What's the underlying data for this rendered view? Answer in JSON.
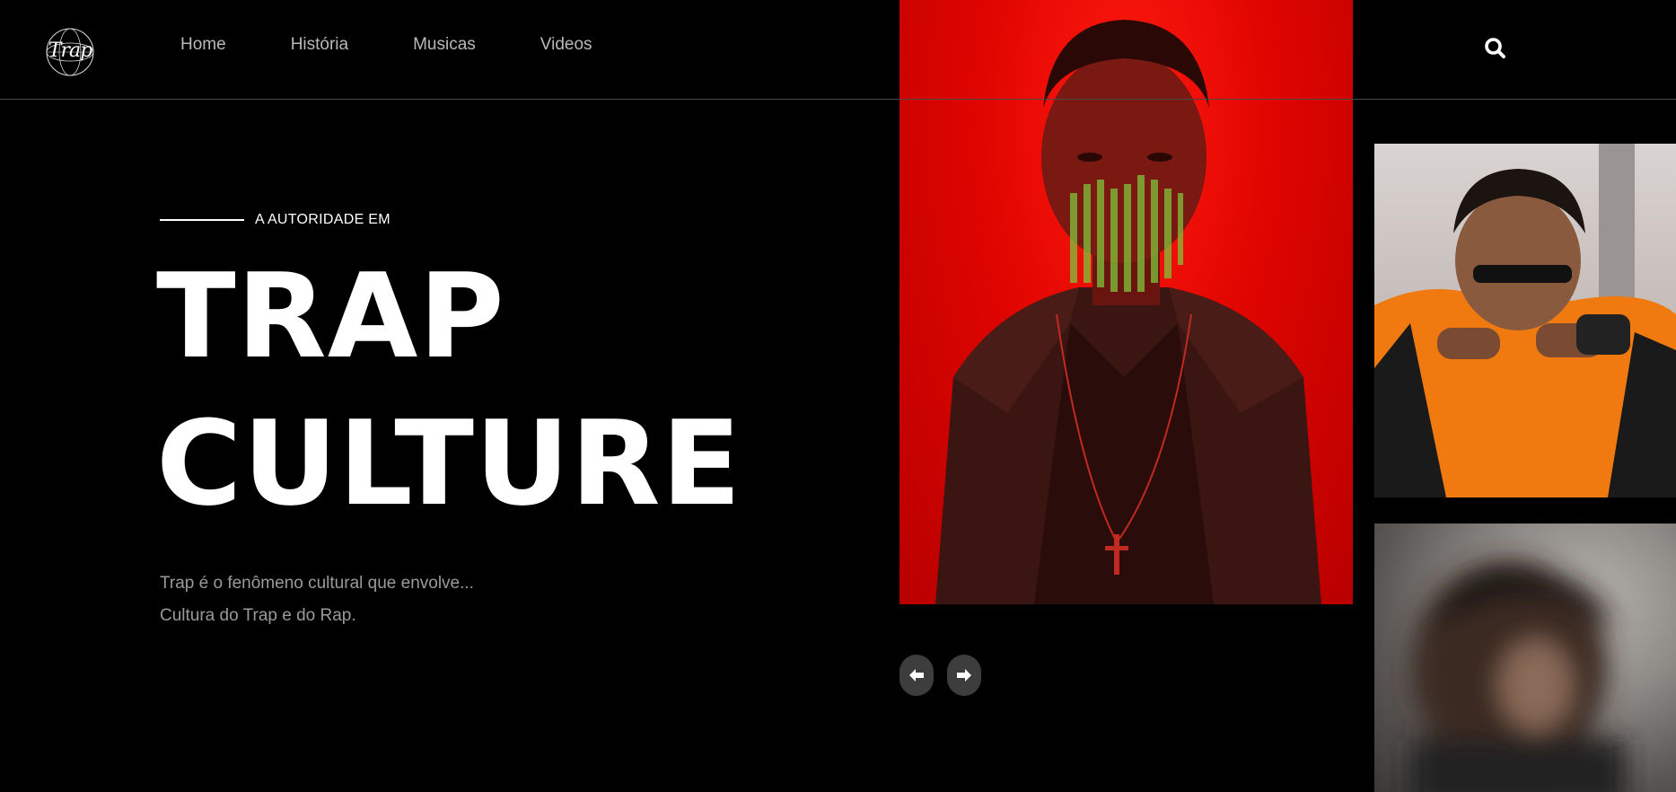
{
  "brand": {
    "logo_text": "Trap",
    "logo_icon": "globe-logo-icon"
  },
  "nav": {
    "items": [
      {
        "label": "Home"
      },
      {
        "label": "História"
      },
      {
        "label": "Musicas"
      },
      {
        "label": "Videos"
      }
    ]
  },
  "search": {
    "icon": "search-icon"
  },
  "hero": {
    "eyebrow": "A AUTORIDADE EM",
    "headline_line1": "TRAP",
    "headline_line2": "CULTURE",
    "description_line1": "Trap é o fenômeno cultural que envolve...",
    "description_line2": "Cultura do Trap e do Rap."
  },
  "gallery": {
    "prev_icon": "arrow-left-icon",
    "next_icon": "arrow-right-icon"
  },
  "colors": {
    "background": "#000000",
    "accent_red": "#e00500",
    "nav_text": "#b9b9b9",
    "desc_text": "#9a9a9a",
    "arrow_bg": "#3d3d3d",
    "divider": "#4a4a4a"
  }
}
